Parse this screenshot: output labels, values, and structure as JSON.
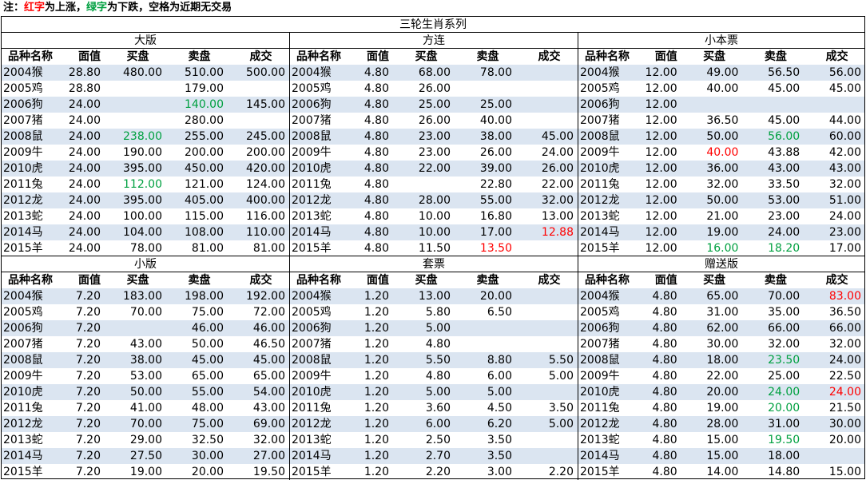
{
  "note": {
    "prefix": "注：",
    "red_word": "红字",
    "middle": "为上涨，",
    "green_word": "绿字",
    "suffix": "为下跌，空格为近期无交易"
  },
  "title": "三轮生肖系列",
  "headers": [
    "品种名称",
    "面值",
    "买盘",
    "卖盘",
    "成交"
  ],
  "colors": {
    "up": "#ff0000",
    "down": "#00a040",
    "alt_row": "#dbe5f1"
  },
  "panels": [
    {
      "title": "大版",
      "rows": [
        {
          "name": "2004猴",
          "face": "28.80",
          "buy": "480.00",
          "sell": "510.00",
          "deal": "500.00"
        },
        {
          "name": "2005鸡",
          "face": "28.80",
          "buy": "",
          "sell": "179.00",
          "deal": ""
        },
        {
          "name": "2006狗",
          "face": "24.00",
          "buy": "",
          "sell": "140.00",
          "deal": "145.00",
          "sell_c": "down"
        },
        {
          "name": "2007猪",
          "face": "24.00",
          "buy": "",
          "sell": "280.00",
          "deal": ""
        },
        {
          "name": "2008鼠",
          "face": "24.00",
          "buy": "238.00",
          "sell": "255.00",
          "deal": "245.00",
          "buy_c": "down"
        },
        {
          "name": "2009牛",
          "face": "24.00",
          "buy": "190.00",
          "sell": "200.00",
          "deal": "200.00"
        },
        {
          "name": "2010虎",
          "face": "24.00",
          "buy": "395.00",
          "sell": "450.00",
          "deal": "420.00"
        },
        {
          "name": "2011兔",
          "face": "24.00",
          "buy": "112.00",
          "sell": "121.00",
          "deal": "124.00",
          "buy_c": "down"
        },
        {
          "name": "2012龙",
          "face": "24.00",
          "buy": "395.00",
          "sell": "405.00",
          "deal": "400.00"
        },
        {
          "name": "2013蛇",
          "face": "24.00",
          "buy": "100.00",
          "sell": "115.00",
          "deal": "116.00"
        },
        {
          "name": "2014马",
          "face": "24.00",
          "buy": "104.00",
          "sell": "108.00",
          "deal": "110.00"
        },
        {
          "name": "2015羊",
          "face": "24.00",
          "buy": "78.00",
          "sell": "81.00",
          "deal": "81.00"
        }
      ]
    },
    {
      "title": "方连",
      "rows": [
        {
          "name": "2004猴",
          "face": "4.80",
          "buy": "68.00",
          "sell": "78.00",
          "deal": ""
        },
        {
          "name": "2005鸡",
          "face": "4.80",
          "buy": "26.00",
          "sell": "",
          "deal": ""
        },
        {
          "name": "2006狗",
          "face": "4.80",
          "buy": "25.00",
          "sell": "25.00",
          "deal": ""
        },
        {
          "name": "2007猪",
          "face": "4.80",
          "buy": "26.00",
          "sell": "40.00",
          "deal": ""
        },
        {
          "name": "2008鼠",
          "face": "4.80",
          "buy": "23.00",
          "sell": "38.00",
          "deal": "45.00"
        },
        {
          "name": "2009牛",
          "face": "4.80",
          "buy": "23.00",
          "sell": "26.00",
          "deal": "24.00"
        },
        {
          "name": "2010虎",
          "face": "4.80",
          "buy": "22.00",
          "sell": "39.00",
          "deal": "26.00"
        },
        {
          "name": "2011兔",
          "face": "4.80",
          "buy": "",
          "sell": "22.80",
          "deal": "22.00"
        },
        {
          "name": "2012龙",
          "face": "4.80",
          "buy": "28.00",
          "sell": "55.00",
          "deal": "32.00"
        },
        {
          "name": "2013蛇",
          "face": "4.80",
          "buy": "10.00",
          "sell": "16.80",
          "deal": "13.00"
        },
        {
          "name": "2014马",
          "face": "4.80",
          "buy": "10.00",
          "sell": "17.00",
          "deal": "12.88",
          "deal_c": "up"
        },
        {
          "name": "2015羊",
          "face": "4.80",
          "buy": "11.50",
          "sell": "13.50",
          "deal": "",
          "sell_c": "up"
        }
      ]
    },
    {
      "title": "小本票",
      "rows": [
        {
          "name": "2004猴",
          "face": "12.00",
          "buy": "49.00",
          "sell": "56.50",
          "deal": "56.00"
        },
        {
          "name": "2005鸡",
          "face": "12.00",
          "buy": "40.00",
          "sell": "45.00",
          "deal": "45.00"
        },
        {
          "name": "2006狗",
          "face": "12.00",
          "buy": "",
          "sell": "",
          "deal": ""
        },
        {
          "name": "2007猪",
          "face": "12.00",
          "buy": "36.50",
          "sell": "45.00",
          "deal": "44.00"
        },
        {
          "name": "2008鼠",
          "face": "12.00",
          "buy": "50.00",
          "sell": "56.00",
          "deal": "60.00",
          "sell_c": "down"
        },
        {
          "name": "2009牛",
          "face": "12.00",
          "buy": "40.00",
          "sell": "43.88",
          "deal": "42.00",
          "buy_c": "up"
        },
        {
          "name": "2010虎",
          "face": "12.00",
          "buy": "36.00",
          "sell": "43.00",
          "deal": "43.00"
        },
        {
          "name": "2011兔",
          "face": "12.00",
          "buy": "32.00",
          "sell": "33.50",
          "deal": "32.00"
        },
        {
          "name": "2012龙",
          "face": "12.00",
          "buy": "50.00",
          "sell": "53.00",
          "deal": "51.00"
        },
        {
          "name": "2013蛇",
          "face": "12.00",
          "buy": "21.00",
          "sell": "23.00",
          "deal": "24.00"
        },
        {
          "name": "2014马",
          "face": "12.00",
          "buy": "19.00",
          "sell": "24.00",
          "deal": "23.00"
        },
        {
          "name": "2015羊",
          "face": "12.00",
          "buy": "16.00",
          "sell": "18.20",
          "deal": "17.00",
          "buy_c": "down",
          "sell_c": "down"
        }
      ]
    },
    {
      "title": "小版",
      "rows": [
        {
          "name": "2004猴",
          "face": "7.20",
          "buy": "183.00",
          "sell": "198.00",
          "deal": "192.00"
        },
        {
          "name": "2005鸡",
          "face": "7.20",
          "buy": "70.00",
          "sell": "75.00",
          "deal": "72.00"
        },
        {
          "name": "2006狗",
          "face": "7.20",
          "buy": "",
          "sell": "46.00",
          "deal": "46.00"
        },
        {
          "name": "2007猪",
          "face": "7.20",
          "buy": "43.00",
          "sell": "50.00",
          "deal": "46.50"
        },
        {
          "name": "2008鼠",
          "face": "7.20",
          "buy": "38.00",
          "sell": "45.00",
          "deal": "45.00"
        },
        {
          "name": "2009牛",
          "face": "7.20",
          "buy": "53.00",
          "sell": "65.00",
          "deal": "65.00"
        },
        {
          "name": "2010虎",
          "face": "7.20",
          "buy": "50.00",
          "sell": "55.00",
          "deal": "54.00"
        },
        {
          "name": "2011兔",
          "face": "7.20",
          "buy": "41.00",
          "sell": "48.00",
          "deal": "43.00"
        },
        {
          "name": "2012龙",
          "face": "7.20",
          "buy": "70.00",
          "sell": "75.00",
          "deal": "69.00"
        },
        {
          "name": "2013蛇",
          "face": "7.20",
          "buy": "29.00",
          "sell": "32.50",
          "deal": "32.00"
        },
        {
          "name": "2014马",
          "face": "7.20",
          "buy": "27.50",
          "sell": "30.00",
          "deal": "27.00"
        },
        {
          "name": "2015羊",
          "face": "7.20",
          "buy": "19.00",
          "sell": "20.00",
          "deal": "19.50"
        }
      ]
    },
    {
      "title": "套票",
      "rows": [
        {
          "name": "2004猴",
          "face": "1.20",
          "buy": "13.00",
          "sell": "20.00",
          "deal": ""
        },
        {
          "name": "2005鸡",
          "face": "1.20",
          "buy": "5.80",
          "sell": "6.50",
          "deal": ""
        },
        {
          "name": "2006狗",
          "face": "1.20",
          "buy": "5.00",
          "sell": "",
          "deal": ""
        },
        {
          "name": "2007猪",
          "face": "1.20",
          "buy": "4.80",
          "sell": "",
          "deal": ""
        },
        {
          "name": "2008鼠",
          "face": "1.20",
          "buy": "5.50",
          "sell": "8.80",
          "deal": "5.50"
        },
        {
          "name": "2009牛",
          "face": "1.20",
          "buy": "4.80",
          "sell": "6.00",
          "deal": "5.00"
        },
        {
          "name": "2010虎",
          "face": "1.20",
          "buy": "5.00",
          "sell": "5.00",
          "deal": ""
        },
        {
          "name": "2011兔",
          "face": "1.20",
          "buy": "3.60",
          "sell": "4.50",
          "deal": "3.50"
        },
        {
          "name": "2012龙",
          "face": "1.20",
          "buy": "6.00",
          "sell": "6.20",
          "deal": "5.00"
        },
        {
          "name": "2013蛇",
          "face": "1.20",
          "buy": "2.50",
          "sell": "3.50",
          "deal": ""
        },
        {
          "name": "2014马",
          "face": "1.20",
          "buy": "2.70",
          "sell": "3.50",
          "deal": ""
        },
        {
          "name": "2015羊",
          "face": "1.20",
          "buy": "2.20",
          "sell": "3.00",
          "deal": "2.20"
        }
      ]
    },
    {
      "title": "赠送版",
      "rows": [
        {
          "name": "2004猴",
          "face": "4.80",
          "buy": "65.00",
          "sell": "70.00",
          "deal": "83.00",
          "deal_c": "up"
        },
        {
          "name": "2005鸡",
          "face": "4.80",
          "buy": "31.00",
          "sell": "35.00",
          "deal": "36.50"
        },
        {
          "name": "2006狗",
          "face": "4.80",
          "buy": "62.00",
          "sell": "66.00",
          "deal": "66.00"
        },
        {
          "name": "2007猪",
          "face": "4.80",
          "buy": "30.00",
          "sell": "32.00",
          "deal": "32.00"
        },
        {
          "name": "2008鼠",
          "face": "4.80",
          "buy": "18.00",
          "sell": "23.50",
          "deal": "24.00",
          "sell_c": "down"
        },
        {
          "name": "2009牛",
          "face": "4.80",
          "buy": "22.00",
          "sell": "25.00",
          "deal": "22.50"
        },
        {
          "name": "2010虎",
          "face": "4.80",
          "buy": "20.00",
          "sell": "24.00",
          "deal": "24.00",
          "sell_c": "down",
          "deal_c": "up"
        },
        {
          "name": "2011兔",
          "face": "4.80",
          "buy": "19.00",
          "sell": "20.00",
          "deal": "21.50",
          "sell_c": "down"
        },
        {
          "name": "2012龙",
          "face": "4.80",
          "buy": "28.00",
          "sell": "31.00",
          "deal": "30.00"
        },
        {
          "name": "2013蛇",
          "face": "4.80",
          "buy": "15.00",
          "sell": "19.50",
          "deal": "20.00",
          "sell_c": "down"
        },
        {
          "name": "2014马",
          "face": "4.80",
          "buy": "15.00",
          "sell": "18.00",
          "deal": ""
        },
        {
          "name": "2015羊",
          "face": "4.80",
          "buy": "14.00",
          "sell": "14.80",
          "deal": "15.00"
        }
      ]
    }
  ]
}
